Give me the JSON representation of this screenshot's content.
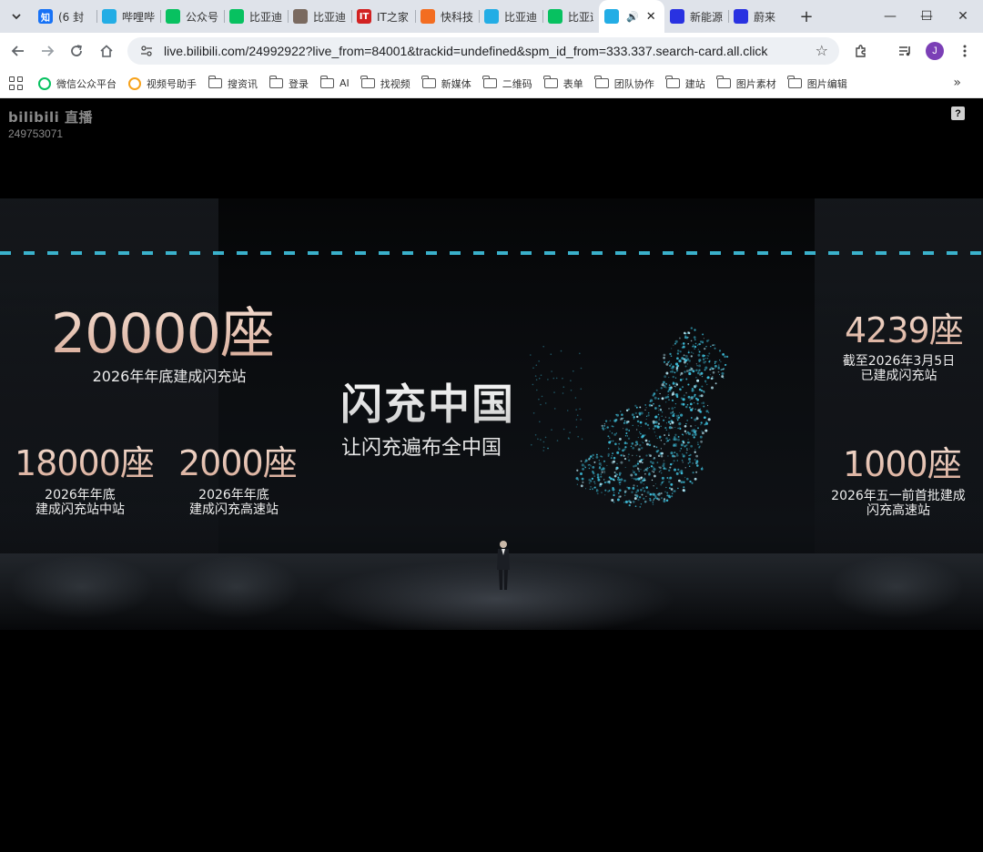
{
  "browser": {
    "tabs": [
      {
        "title": "(6 封",
        "favicon_text": "知",
        "favicon_color": "#1772f6"
      },
      {
        "title": "哔哩哔",
        "favicon_text": "",
        "favicon_color": "#23ade5"
      },
      {
        "title": "公众号",
        "favicon_text": "",
        "favicon_color": "#07c160"
      },
      {
        "title": "比亚迪",
        "favicon_text": "",
        "favicon_color": "#07c160"
      },
      {
        "title": "比亚迪",
        "favicon_text": "",
        "favicon_color": "#7a6a60"
      },
      {
        "title": "IT之家",
        "favicon_text": "IT",
        "favicon_color": "#d22222"
      },
      {
        "title": "快科技",
        "favicon_text": "",
        "favicon_color": "#f36d21"
      },
      {
        "title": "比亚迪",
        "favicon_text": "",
        "favicon_color": "#23ade5"
      },
      {
        "title": "比亚迪",
        "favicon_text": "",
        "favicon_color": "#07c160"
      },
      {
        "title": "",
        "favicon_text": "",
        "favicon_color": "#23ade5",
        "active": true,
        "audio_icon": "speaker-icon",
        "close": "✕"
      },
      {
        "title": "新能源",
        "favicon_text": "",
        "favicon_color": "#2932e1"
      },
      {
        "title": "蔚来",
        "favicon_text": "",
        "favicon_color": "#2932e1"
      }
    ],
    "new_tab": "+",
    "window_controls": {
      "minimize": "—",
      "maximize": "☐",
      "close": "✕"
    },
    "url": "live.bilibili.com/24992922?live_from=84001&trackid=undefined&spm_id_from=333.337.search-card.all.click",
    "avatar_letter": "J",
    "avatar_color": "#7b3fb6"
  },
  "bookmarks": [
    {
      "label": "微信公众平台",
      "type": "site",
      "icon": "wechat-icon",
      "color": "#07c160"
    },
    {
      "label": "视频号助手",
      "type": "site",
      "icon": "channels-icon",
      "color": "#f7a21b"
    },
    {
      "label": "搜资讯",
      "type": "folder"
    },
    {
      "label": "登录",
      "type": "folder"
    },
    {
      "label": "AI",
      "type": "folder"
    },
    {
      "label": "找视频",
      "type": "folder"
    },
    {
      "label": "新媒体",
      "type": "folder"
    },
    {
      "label": "二维码",
      "type": "folder"
    },
    {
      "label": "表单",
      "type": "folder"
    },
    {
      "label": "团队协作",
      "type": "folder"
    },
    {
      "label": "建站",
      "type": "folder"
    },
    {
      "label": "图片素材",
      "type": "folder"
    },
    {
      "label": "图片编辑",
      "type": "folder"
    }
  ],
  "bookmarks_more": "»",
  "live": {
    "brand": "bilibili 直播",
    "room_id": "249753071",
    "help": "?"
  },
  "slide": {
    "title": "闪充中国",
    "subtitle": "让闪充遍布全中国",
    "stats": {
      "main_left": {
        "value": "20000座",
        "caption": "2026年年底建成闪充站"
      },
      "left_1": {
        "value": "18000座",
        "caption_line1": "2026年年底",
        "caption_line2": "建成闪充站中站"
      },
      "left_2": {
        "value": "2000座",
        "caption_line1": "2026年年底",
        "caption_line2": "建成闪充高速站"
      },
      "right_1": {
        "value": "4239座",
        "caption_line1": "截至2026年3月5日",
        "caption_line2": "已建成闪充站"
      },
      "right_2": {
        "value": "1000座",
        "caption_line1": "2026年五一前首批建成",
        "caption_line2": "闪充高速站"
      }
    },
    "accent_color": "#3fc3e0"
  }
}
